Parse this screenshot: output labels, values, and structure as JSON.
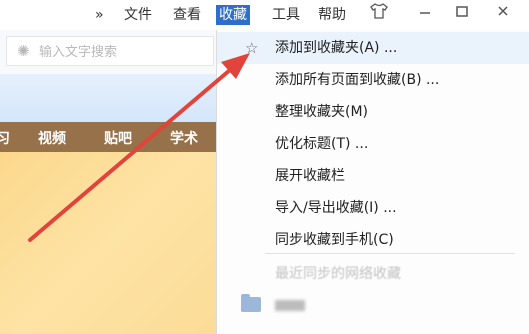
{
  "menubar": {
    "overflow": "»",
    "file": "文件",
    "view": "查看",
    "favorites": "收藏",
    "tools": "工具",
    "help": "帮助",
    "icons": [
      "shirt-icon",
      "minimize-icon",
      "maximize-icon",
      "close-icon"
    ]
  },
  "search": {
    "placeholder": "输入文字搜索"
  },
  "nav": {
    "items": [
      "视频",
      "贴吧",
      "学术"
    ],
    "partial": "习"
  },
  "favorites_menu": {
    "items": [
      "添加到收藏夹(A) ...",
      "添加所有页面到收藏(B) ...",
      "整理收藏夹(M)",
      "优化标题(T) ...",
      "展开收藏栏",
      "导入/导出收藏(I) ...",
      "同步收藏到手机(C)"
    ],
    "disabled_item": "最近同步的网络收藏"
  },
  "colors": {
    "menu_active": "#2f6fc9",
    "arrow": "#e0443a",
    "nav_bar": "#96714a"
  }
}
